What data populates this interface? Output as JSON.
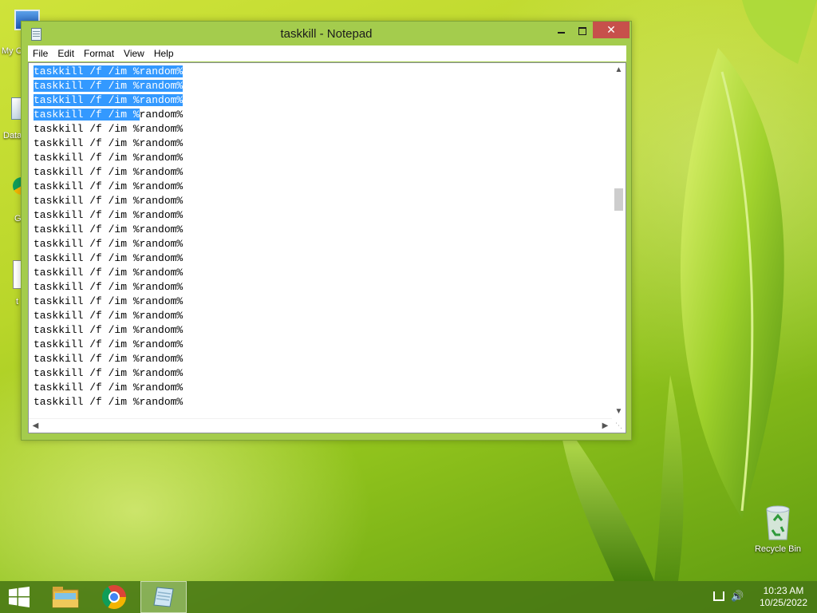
{
  "desktop": {
    "icons": {
      "recycle_bin": "Recycle Bin",
      "my_computer_fragment": "My C",
      "data_fragment": "Data",
      "g_fragment": "G",
      "t_fragment": "t"
    }
  },
  "window": {
    "title": "taskkill - Notepad",
    "controls": {
      "close": "✕"
    },
    "menu": [
      "File",
      "Edit",
      "Format",
      "View",
      "Help"
    ],
    "text_lines": [
      "taskkill /f /im %random%",
      "taskkill /f /im %random%",
      "taskkill /f /im %random%",
      "taskkill /f /im %random%",
      "taskkill /f /im %random%",
      "taskkill /f /im %random%",
      "taskkill /f /im %random%",
      "taskkill /f /im %random%",
      "taskkill /f /im %random%",
      "taskkill /f /im %random%",
      "taskkill /f /im %random%",
      "taskkill /f /im %random%",
      "taskkill /f /im %random%",
      "taskkill /f /im %random%",
      "taskkill /f /im %random%",
      "taskkill /f /im %random%",
      "taskkill /f /im %random%",
      "taskkill /f /im %random%",
      "taskkill /f /im %random%",
      "taskkill /f /im %random%",
      "taskkill /f /im %random%",
      "taskkill /f /im %random%",
      "taskkill /f /im %random%",
      "taskkill /f /im %random%"
    ],
    "selection": {
      "full_lines": 3,
      "partial_line_chars": 17
    }
  },
  "taskbar": {
    "apps": [
      "start-button",
      "file-explorer",
      "chrome",
      "notepad"
    ],
    "clock": {
      "time": "10:23 AM",
      "date": "10/25/2022"
    }
  },
  "colors": {
    "window_frame": "#a4cc4d",
    "close_button": "#c7504b",
    "selection": "#3399ff",
    "taskbar": "#487814"
  }
}
